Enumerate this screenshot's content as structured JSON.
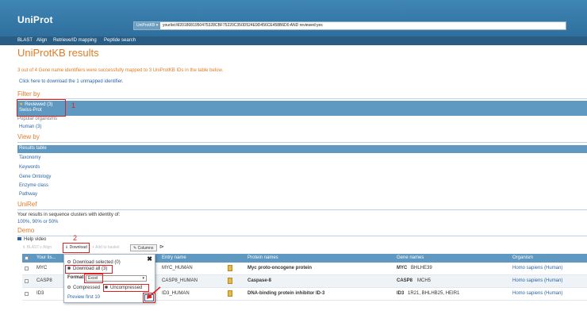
{
  "header": {
    "logo_text": "UniProt",
    "search_scope": "UniProtKB ▾",
    "search_query": "yourlist:M2018081950475328CBF75220C350D524E9D456CE458B6D0 AND reviewed:yes"
  },
  "nav": {
    "items": [
      "BLAST",
      "Align",
      "Retrieve/ID mapping",
      "Peptide search"
    ]
  },
  "page_title": "UniProtKB results",
  "mapping_message": "3 out of 4 Gene name identifiers were successfully mapped to 3 UniProtKB IDs in the table below.",
  "unmapped_link": "Click here to download the 1 unmapped identifier.",
  "filter": {
    "heading": "Filter by",
    "reviewed": "Reviewed (3)",
    "swissprot": "Swiss-Prot",
    "popular_heading": "Popular organisms",
    "human": "Human (3)"
  },
  "view_by": {
    "heading": "View by",
    "items": [
      "Results table",
      "Taxonomy",
      "Keywords",
      "Gene Ontology",
      "Enzyme class",
      "Pathway"
    ]
  },
  "uniref": {
    "heading": "UniRef",
    "text": "Your results in sequence clusters with identity of:",
    "links": "100%, 90% or 50%"
  },
  "demo": {
    "heading": "Demo",
    "help_video": "Help video"
  },
  "toolbar": {
    "blast": "BLAST",
    "align": "Align",
    "download": "Download",
    "basket": "Add to basket",
    "columns": "Columns"
  },
  "table": {
    "headers": [
      "Your lis...",
      "Entry name",
      "Protein names",
      "Gene names",
      "Organism"
    ],
    "rows": [
      {
        "list": "MYC",
        "entry_name": "MYC_HUMAN",
        "protein": "Myc proto-oncogene protein",
        "gene_main": "MYC",
        "gene_rest": "BHLHE39",
        "organism": "Homo sapiens (Human)"
      },
      {
        "list": "CASP8",
        "entry_name": "CASP8_HUMAN",
        "protein": "Caspase-8",
        "gene_main": "CASP8",
        "gene_rest": "MCH5",
        "organism": "Homo sapiens (Human)"
      },
      {
        "list": "ID3",
        "entry_name": "ID3_HUMAN",
        "protein": "DNA-binding protein inhibitor ID-3",
        "gene_main": "ID3",
        "gene_rest": "1R21, BHLHB25, HEIR1",
        "organism": "Homo sapiens (Human)"
      }
    ]
  },
  "download_popup": {
    "download_selected": "Download selected (0)",
    "download_all": "Download all (3)",
    "format_label": "Format:",
    "format_value": "Excel",
    "compressed": "Compressed",
    "uncompressed": "Uncompressed",
    "preview": "Preview first 10",
    "go": "Go"
  },
  "annotations": {
    "step1": "1",
    "step2": "2"
  },
  "colors": {
    "accent_orange": "#e07b24",
    "header_blue": "#3f86b5",
    "table_blue": "#5f98c0",
    "annotation_red": "#e02020"
  }
}
